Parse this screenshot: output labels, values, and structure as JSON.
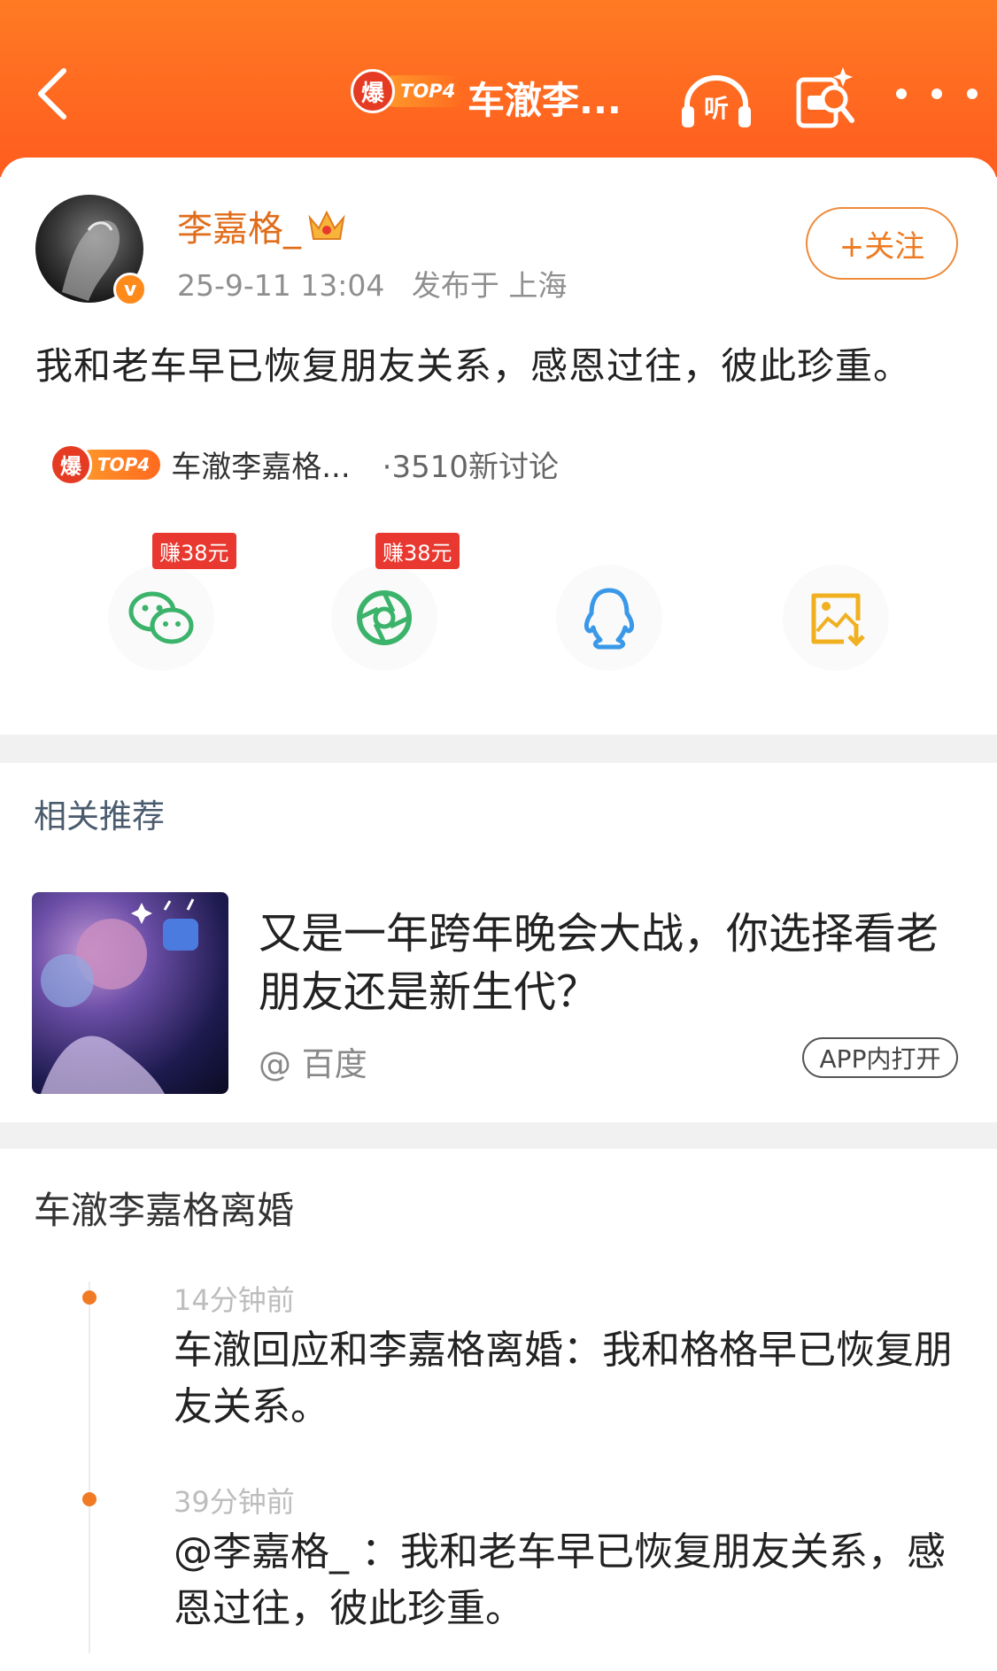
{
  "header": {
    "boom_char": "爆",
    "rank": "TOP4",
    "title": "车澈李...",
    "listen_char": "听",
    "icons": [
      "back-icon",
      "listen-icon",
      "gift-icon",
      "more-icon"
    ]
  },
  "post": {
    "username": "李嘉格_",
    "verified_char": "v",
    "time": "25-9-11 13:04",
    "location": "发布于 上海",
    "follow_label": "+关注",
    "text": "我和老车早已恢复朋友关系，感恩过往，彼此珍重。",
    "topic": {
      "boom_char": "爆",
      "rank": "TOP4",
      "name": "车澈李嘉格...",
      "count": "·3510新讨论"
    },
    "share": [
      {
        "icon": "wechat-icon",
        "badge": "赚38元"
      },
      {
        "icon": "moments-icon",
        "badge": "赚38元"
      },
      {
        "icon": "qq-icon",
        "badge": ""
      },
      {
        "icon": "save-image-icon",
        "badge": ""
      }
    ]
  },
  "recommend": {
    "heading": "相关推荐",
    "title": "又是一年跨年晚会大战，你选择看老朋友还是新生代？",
    "source": "@ 百度",
    "open_label": "APP内打开"
  },
  "timeline": {
    "heading": "车澈李嘉格离婚",
    "items": [
      {
        "time": "14分钟前",
        "text": "车澈回应和李嘉格离婚：我和格格早已恢复朋友关系。"
      },
      {
        "time": "39分钟前",
        "text": "@李嘉格_ ：我和老车早已恢复朋友关系，感恩过往，彼此珍重。"
      }
    ]
  },
  "colors": {
    "header": "#ff6a21",
    "accent": "#ee7a22",
    "badge_red": "#e8382f",
    "wechat": "#3bb36b",
    "qq": "#3a98e8",
    "save": "#f0b020"
  }
}
